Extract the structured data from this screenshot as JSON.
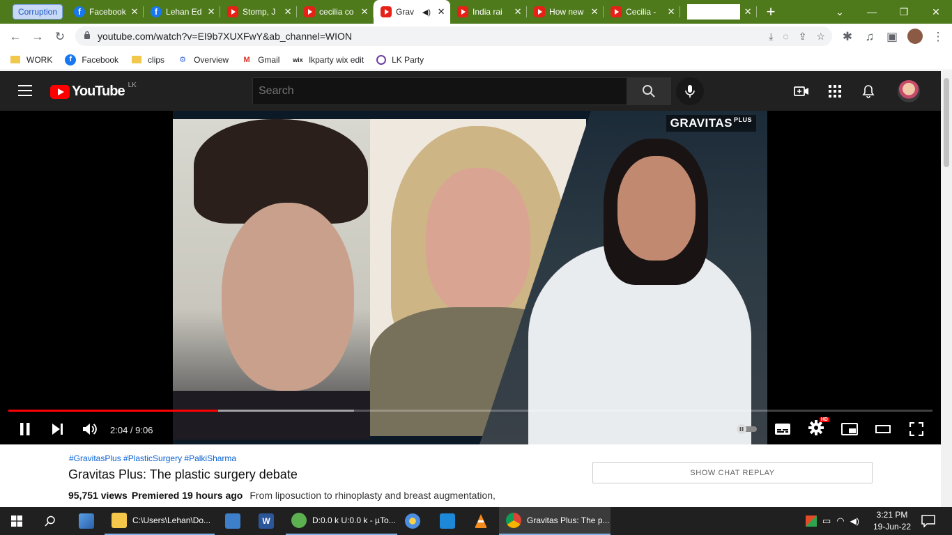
{
  "browser": {
    "tab_group": "Corruption",
    "tabs": [
      {
        "title": "Facebook",
        "icon": "facebook-icon"
      },
      {
        "title": "Lehan Ed",
        "icon": "facebook-icon"
      },
      {
        "title": "Stomp, J",
        "icon": "youtube-icon"
      },
      {
        "title": "cecilia co",
        "icon": "youtube-icon"
      },
      {
        "title": "Grav",
        "icon": "youtube-icon",
        "active": true,
        "audio": true
      },
      {
        "title": "India rai",
        "icon": "youtube-icon"
      },
      {
        "title": "How new",
        "icon": "youtube-icon"
      },
      {
        "title": "Cecilia -",
        "icon": "youtube-icon"
      }
    ],
    "url": "youtube.com/watch?v=EI9b7XUXFwY&ab_channel=WION",
    "bookmarks": [
      {
        "label": "WORK",
        "icon": "folder-icon"
      },
      {
        "label": "Facebook",
        "icon": "facebook-icon"
      },
      {
        "label": "clips",
        "icon": "folder-icon"
      },
      {
        "label": "Overview",
        "icon": "overview-icon"
      },
      {
        "label": "Gmail",
        "icon": "gmail-icon"
      },
      {
        "label": "lkparty wix edit",
        "icon": "wix-icon"
      },
      {
        "label": "LK Party",
        "icon": "lkparty-icon"
      }
    ]
  },
  "youtube": {
    "logo_text": "YouTube",
    "country_code": "LK",
    "search_placeholder": "Search",
    "video_watermark": "GRAVITAS",
    "video_watermark_sup": "PLUS",
    "player": {
      "current_time": "2:04",
      "duration": "9:06",
      "time_display": "2:04 / 9:06",
      "played_fraction": 0.227,
      "buffered_fraction": 0.374,
      "hd_badge": "HD"
    },
    "video": {
      "hashtags": "#GravitasPlus #PlasticSurgery #PalkiSharma",
      "title": "Gravitas Plus: The plastic surgery debate",
      "views": "95,751 views",
      "premiered": "Premiered 19 hours ago",
      "description_start": "From liposuction to rhinoplasty and breast augmentation,"
    },
    "chat_replay_label": "SHOW CHAT REPLAY"
  },
  "taskbar": {
    "items": [
      {
        "label": "C:\\Users\\Lehan\\Do...",
        "icon": "file-explorer-icon"
      },
      {
        "label": "D:0.0 k U:0.0 k - µTo...",
        "icon": "utorrent-icon"
      },
      {
        "label": "Gravitas Plus: The p...",
        "icon": "chrome-icon"
      }
    ],
    "clock_time": "3:21 PM",
    "clock_date": "19-Jun-22"
  },
  "colors": {
    "tabstrip": "#4e7a1c",
    "yt_header": "#212121",
    "progress_played": "#ff0000",
    "link_blue": "#065fd4",
    "taskbar": "#202020"
  }
}
